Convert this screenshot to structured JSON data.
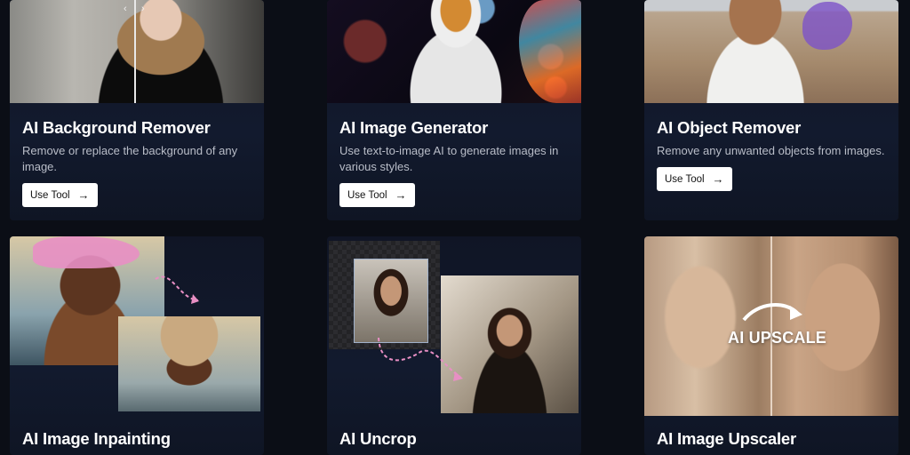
{
  "cards": [
    {
      "title": "AI Background Remover",
      "description": "Remove or replace the background of any image.",
      "button": "Use Tool",
      "image_alt": "bg-remover-sample"
    },
    {
      "title": "AI Image Generator",
      "description": "Use text-to-image AI to generate images in various styles.",
      "button": "Use Tool",
      "image_alt": "image-generator-sample"
    },
    {
      "title": "AI Object Remover",
      "description": "Remove any unwanted objects from images.",
      "button": "Use Tool",
      "image_alt": "object-remover-sample"
    },
    {
      "title": "AI Image Inpainting",
      "image_alt": "inpainting-sample"
    },
    {
      "title": "AI Uncrop",
      "image_alt": "uncrop-sample"
    },
    {
      "title": "AI Image Upscaler",
      "image_overlay_text": "AI UPSCALE",
      "image_alt": "upscaler-sample"
    }
  ],
  "icons": {
    "button_arrow": "arrow-right-icon",
    "slider_chevrons": "chevron-left-right-icon"
  },
  "colors": {
    "page_bg": "#0b0e16",
    "card_bg": "#111827",
    "button_bg": "#ffffff",
    "accent_pink": "#e88fc4",
    "accent_purple": "#7d53c8"
  }
}
